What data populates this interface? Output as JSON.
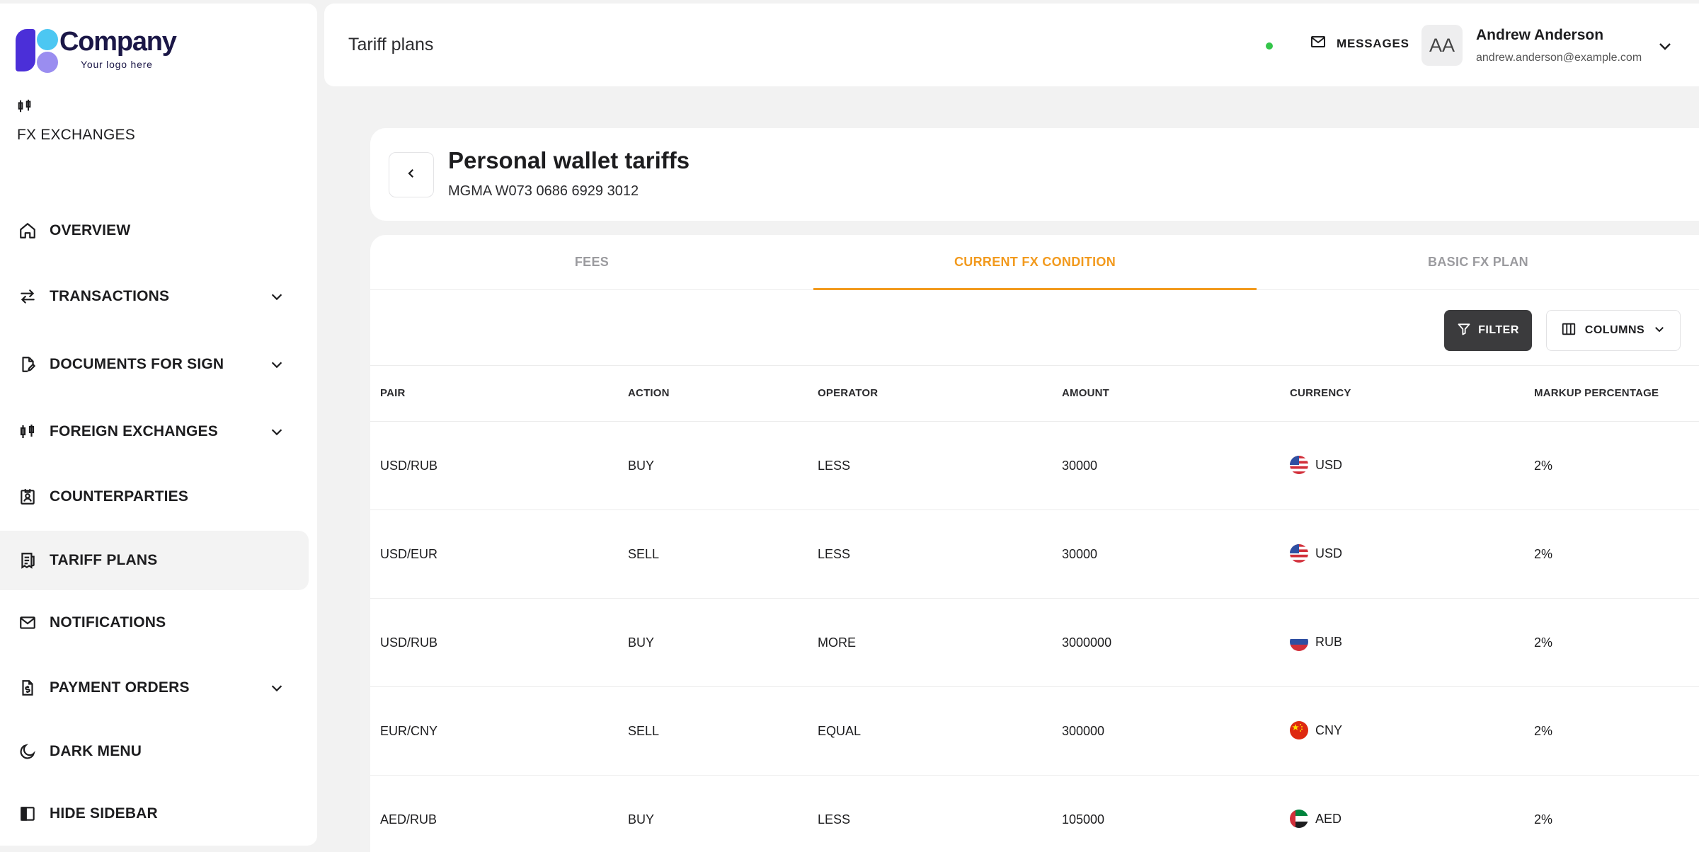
{
  "brand": {
    "name": "Company",
    "tagline": "Your logo here"
  },
  "sidebar": {
    "section_label": "FX EXCHANGES",
    "items": [
      {
        "label": "OVERVIEW",
        "icon": "home-icon",
        "has_submenu": false,
        "active": false
      },
      {
        "label": "TRANSACTIONS",
        "icon": "arrows-swap-icon",
        "has_submenu": true,
        "active": false
      },
      {
        "label": "DOCUMENTS FOR SIGN",
        "icon": "document-sign-icon",
        "has_submenu": true,
        "active": false
      },
      {
        "label": "FOREIGN EXCHANGES",
        "icon": "candlestick-icon",
        "has_submenu": true,
        "active": false
      },
      {
        "label": "COUNTERPARTIES",
        "icon": "badge-icon",
        "has_submenu": false,
        "active": false
      },
      {
        "label": "TARIFF PLANS",
        "icon": "receipt-icon",
        "has_submenu": false,
        "active": true
      },
      {
        "label": "NOTIFICATIONS",
        "icon": "mail-icon",
        "has_submenu": false,
        "active": false
      },
      {
        "label": "PAYMENT ORDERS",
        "icon": "dollar-document-icon",
        "has_submenu": true,
        "active": false
      },
      {
        "label": "DARK MENU",
        "icon": "moon-icon",
        "has_submenu": false,
        "active": false
      },
      {
        "label": "HIDE SIDEBAR",
        "icon": "sidebar-icon",
        "has_submenu": false,
        "active": false
      }
    ]
  },
  "header": {
    "title": "Tariff plans",
    "messages_label": "MESSAGES",
    "user": {
      "initials": "AA",
      "name": "Andrew Anderson",
      "email": "andrew.anderson@example.com"
    }
  },
  "wallet": {
    "title": "Personal wallet tariffs",
    "account": "MGMA W073 0686 6929 3012"
  },
  "tabs": [
    {
      "label": "FEES",
      "active": false
    },
    {
      "label": "CURRENT FX CONDITION",
      "active": true
    },
    {
      "label": "BASIC FX PLAN",
      "active": false
    }
  ],
  "toolbar": {
    "filter_label": "FILTER",
    "columns_label": "COLUMNS"
  },
  "table": {
    "columns": [
      "PAIR",
      "ACTION",
      "OPERATOR",
      "AMOUNT",
      "CURRENCY",
      "MARKUP PERCENTAGE"
    ],
    "rows": [
      {
        "pair": "USD/RUB",
        "action": "BUY",
        "operator": "LESS",
        "amount": "30000",
        "currency": "USD",
        "markup": "2%"
      },
      {
        "pair": "USD/EUR",
        "action": "SELL",
        "operator": "LESS",
        "amount": "30000",
        "currency": "USD",
        "markup": "2%"
      },
      {
        "pair": "USD/RUB",
        "action": "BUY",
        "operator": "MORE",
        "amount": "3000000",
        "currency": "RUB",
        "markup": "2%"
      },
      {
        "pair": "EUR/CNY",
        "action": "SELL",
        "operator": "EQUAL",
        "amount": "300000",
        "currency": "CNY",
        "markup": "2%"
      },
      {
        "pair": "AED/RUB",
        "action": "BUY",
        "operator": "LESS",
        "amount": "105000",
        "currency": "AED",
        "markup": "2%"
      }
    ]
  },
  "colors": {
    "accent": "#f29a1e",
    "status_online": "#34c54a",
    "filter_button": "#3b3b3d"
  }
}
